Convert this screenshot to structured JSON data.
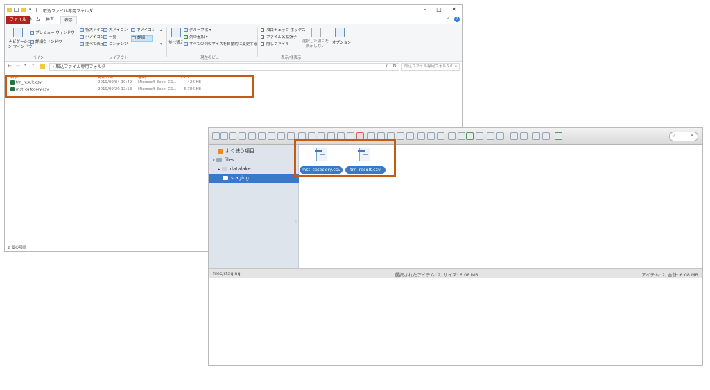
{
  "explorer": {
    "title": "取込ファイル専用フォルダ",
    "tabs": [
      "ファイル",
      "ホーム",
      "共有",
      "表示"
    ],
    "ribbon": {
      "pane": {
        "nav_pane": "ナビゲーション ウィンドウ",
        "preview_pane": "プレビュー ウィンドウ",
        "details_pane": "詳細ウィンドウ",
        "group": "ペイン"
      },
      "layout": {
        "extra_large_icons": "特大アイコン",
        "large_icons": "大アイコン",
        "medium_icons": "中アイコン",
        "small_icons": "小アイコン",
        "list": "一覧",
        "details": "詳細",
        "tiles": "並べて表示",
        "content": "コンテンツ",
        "group": "レイアウト"
      },
      "current_view": {
        "sort_by": "並べ替え",
        "group_by": "グループ化",
        "add_columns": "列の追加",
        "size_columns": "すべての列のサイズを自動的に変更する",
        "group": "現在のビュー"
      },
      "show_hide": {
        "item_checkboxes": "項目チェック ボックス",
        "file_extensions": "ファイル名拡張子",
        "hidden_items": "隠しファイル",
        "hide_selected": "選択した項目を表示しない",
        "group": "表示/非表示"
      },
      "options": "オプション"
    },
    "address": {
      "path": "取込ファイル専用フォルダ",
      "search_placeholder": "取込ファイル専用フォルダの..."
    },
    "columns": [
      "名前",
      "更新日時",
      "種類",
      "サイズ"
    ],
    "files": [
      {
        "name": "trn_result.csv",
        "modified": "2019/09/04 10:49",
        "type": "Microsoft Excel CS...",
        "size": "426 KB"
      },
      {
        "name": "mst_category.csv",
        "modified": "2019/09/20 12:13",
        "type": "Microsoft Excel CS...",
        "size": "5,786 KB"
      }
    ],
    "status": "2 個の項目"
  },
  "browser": {
    "sidebar": {
      "favorites": "よく使う項目",
      "root": "files",
      "children": [
        "datalake",
        "staging"
      ]
    },
    "files": [
      {
        "name": "mst_category.csv",
        "badge": "csv"
      },
      {
        "name": "trn_result.csv",
        "badge": "csv"
      }
    ],
    "status": {
      "path": "files/staging",
      "selected": "選択されたアイテム: 2, サイズ: 6.08 MB",
      "total": "アイテム: 2, 合計: 6.08 MB"
    }
  },
  "colors": {
    "highlight": "#c55a11",
    "selection": "#3a78c9",
    "excel": "#217346",
    "file_tab": "#b5221b"
  }
}
